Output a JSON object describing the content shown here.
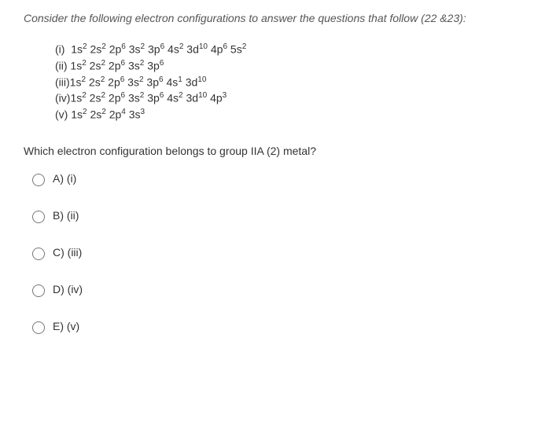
{
  "intro": "Consider the following electron configurations to answer the questions that follow (22 &23):",
  "configs": {
    "c1": {
      "label": "(i)",
      "text": "1s² 2s² 2p⁶ 3s² 3p⁶ 4s² 3d¹⁰ 4p⁶ 5s²"
    },
    "c2": {
      "label": "(ii)",
      "text": "1s² 2s² 2p⁶ 3s² 3p⁶"
    },
    "c3": {
      "label": "(iii)",
      "text": "1s² 2s² 2p⁶ 3s² 3p⁶ 4s¹ 3d¹⁰"
    },
    "c4": {
      "label": "(iv)",
      "text": "1s² 2s² 2p⁶ 3s² 3p⁶ 4s² 3d¹⁰ 4p³"
    },
    "c5": {
      "label": "(v)",
      "text": "1s² 2s² 2p⁴ 3s³"
    }
  },
  "question": "Which electron configuration belongs to group IIA (2) metal?",
  "options": {
    "a": "A) (i)",
    "b": "B) (ii)",
    "c": "C) (iii)",
    "d": "D) (iv)",
    "e": "E) (v)"
  }
}
